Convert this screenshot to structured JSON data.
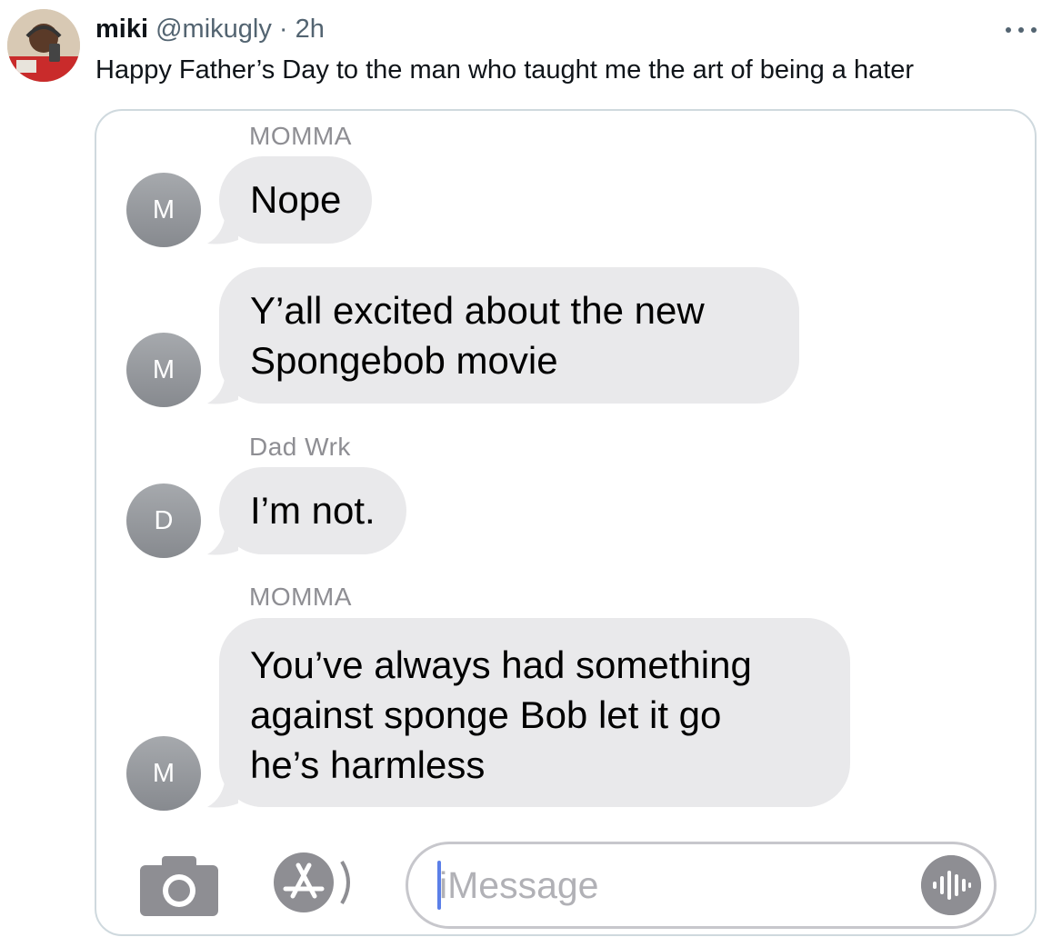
{
  "tweet": {
    "display_name": "miki",
    "handle": "@mikugly",
    "separator": "·",
    "time": "2h",
    "text": "Happy Father’s Day to the man who taught me the art of being a hater",
    "more_icon": "more-horizontal-icon"
  },
  "conversation": {
    "groups": [
      {
        "sender": "MOMMA",
        "initial": "M",
        "lines": [
          "Nope"
        ]
      },
      {
        "sender": "",
        "initial": "M",
        "lines": [
          "Y’all excited about the new",
          "Spongebob movie"
        ]
      },
      {
        "sender": "Dad Wrk",
        "initial": "D",
        "lines": [
          "I’m not."
        ]
      },
      {
        "sender": "MOMMA",
        "initial": "M",
        "lines": [
          "You’ve always had something",
          "against sponge Bob let it go",
          "he’s harmless"
        ]
      }
    ]
  },
  "composer": {
    "placeholder": "iMessage",
    "camera_icon": "camera-icon",
    "apps_icon": "app-store-icon",
    "audio_icon": "audio-waveform-icon"
  },
  "colors": {
    "bubble": "#e9e9eb",
    "avatar_gray": "#999ca0",
    "cursor": "#5b7fe8",
    "border": "#cfd9de"
  }
}
